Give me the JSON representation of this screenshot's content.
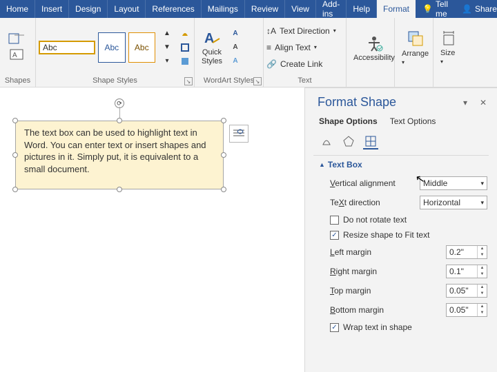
{
  "tabs": {
    "home": "Home",
    "insert": "Insert",
    "design": "Design",
    "layout": "Layout",
    "refs": "References",
    "mail": "Mailings",
    "review": "Review",
    "view": "View",
    "addins": "Add-ins",
    "help": "Help",
    "format": "Format",
    "tell": "Tell me",
    "share": "Share"
  },
  "ribbon": {
    "shapes_label": "Shapes",
    "style_label": "Shape Styles",
    "abc": "Abc",
    "wa_label": "WordArt Styles",
    "quick_styles": "Quick\nStyles",
    "text_label": "Text",
    "text_direction": "Text Direction",
    "align_text": "Align Text",
    "create_link": "Create Link",
    "accessibility": "Accessibility",
    "arrange": "Arrange",
    "size": "Size"
  },
  "doc": {
    "textbox": "The text box can be used to highlight text in Word. You can enter text or insert shapes and pictures in it. Simply put, it is equivalent to a small document."
  },
  "panel": {
    "title": "Format Shape",
    "shape_options": "Shape Options",
    "text_options": "Text Options",
    "section": "Text Box",
    "valign_label": "Vertical alignment",
    "valign_key": "V",
    "valign": "Middle",
    "tdir_label": "Text direction",
    "tdir_key": "X",
    "tdir": "Horizontal",
    "no_rotate": "Do not rotate text",
    "no_rotate_key": "D",
    "resize": "Resize shape to fit text",
    "resize_key": "F",
    "resize_checked": true,
    "left_label": "Left margin",
    "left_key": "L",
    "left": "0.2\"",
    "right_label": "Right margin",
    "right_key": "R",
    "right": "0.1\"",
    "top_label": "Top margin",
    "top_key": "T",
    "top": "0.05\"",
    "bottom_label": "Bottom margin",
    "bottom_key": "B",
    "bottom": "0.05\"",
    "wrap": "Wrap text in shape",
    "wrap_key": "W",
    "wrap_checked": true
  }
}
